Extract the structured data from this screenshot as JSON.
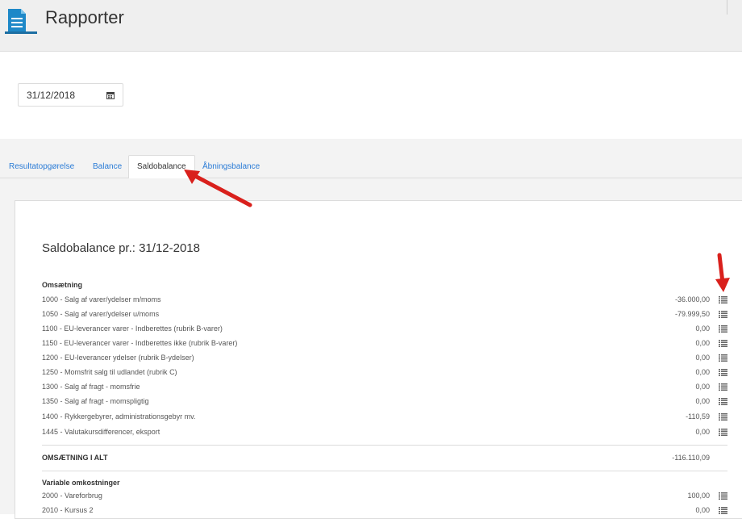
{
  "header": {
    "title": "Rapporter",
    "icon": "document-icon"
  },
  "date_field": {
    "value": "31/12/2018",
    "icon": "calendar-icon"
  },
  "tabs": [
    {
      "label": "Resultatopgørelse",
      "active": false
    },
    {
      "label": "Balance",
      "active": false
    },
    {
      "label": "Saldobalance",
      "active": true
    },
    {
      "label": "Åbningsbalance",
      "active": false
    }
  ],
  "report": {
    "title": "Saldobalance pr.: 31/12-2018",
    "sections": [
      {
        "heading": "Omsætning",
        "rows": [
          {
            "label": "1000 - Salg af varer/ydelser m/moms",
            "value": "-36.000,00"
          },
          {
            "label": "1050 - Salg af varer/ydelser u/moms",
            "value": "-79.999,50"
          },
          {
            "label": "1100 - EU-leverancer varer - Indberettes (rubrik B-varer)",
            "value": "0,00"
          },
          {
            "label": "1150 - EU-leverancer varer - Indberettes ikke (rubrik B-varer)",
            "value": "0,00"
          },
          {
            "label": "1200 - EU-leverancer ydelser (rubrik B-ydelser)",
            "value": "0,00"
          },
          {
            "label": "1250 - Momsfrit salg til udlandet (rubrik C)",
            "value": "0,00"
          },
          {
            "label": "1300 - Salg af fragt - momsfrie",
            "value": "0,00"
          },
          {
            "label": "1350 - Salg af fragt - momspligtig",
            "value": "0,00"
          },
          {
            "label": "1400 - Rykkergebyrer, administrationsgebyr mv.",
            "value": "-110,59"
          },
          {
            "label": "1445 - Valutakursdifferencer, eksport",
            "value": "0,00"
          }
        ],
        "total": {
          "label": "OMSÆTNING I ALT",
          "value": "-116.110,09"
        }
      },
      {
        "heading": "Variable omkostninger",
        "rows": [
          {
            "label": "2000 - Vareforbrug",
            "value": "100,00"
          },
          {
            "label": "2010 - Kursus 2",
            "value": "0,00"
          }
        ]
      }
    ]
  },
  "colors": {
    "link": "#2a7bd6",
    "arrow": "#d9201c",
    "icon_blue": "#1e88c8"
  }
}
